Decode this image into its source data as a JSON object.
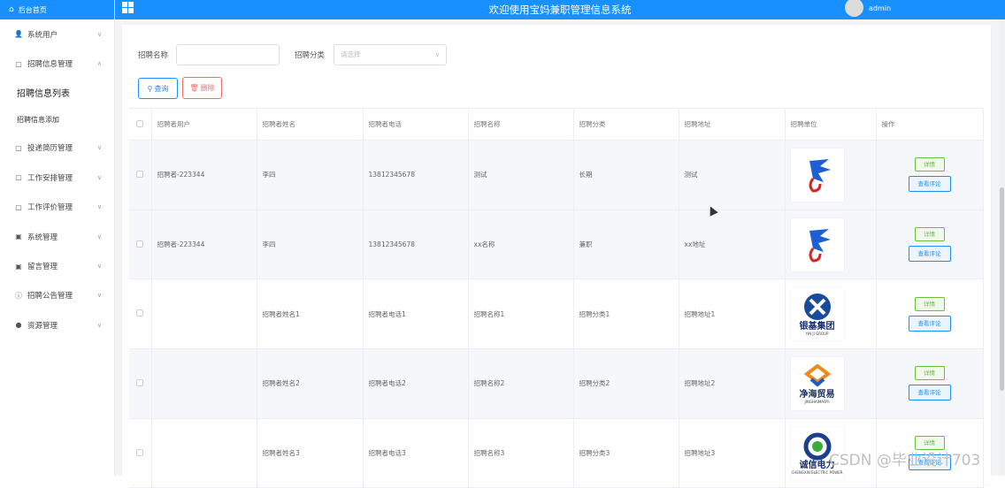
{
  "sidebar": {
    "home_label": "后台首页",
    "menu_top": [
      {
        "label": "系统用户",
        "icon": "user-icon"
      },
      {
        "label": "招聘信息管理",
        "icon": "doc-icon"
      }
    ],
    "submenu": [
      {
        "label": "招聘信息列表"
      },
      {
        "label": "招聘信息添加"
      }
    ],
    "menu_rest": [
      {
        "label": "投递简历管理",
        "icon": "doc-icon"
      },
      {
        "label": "工作安排管理",
        "icon": "doc-icon"
      },
      {
        "label": "工作评价管理",
        "icon": "doc-icon"
      },
      {
        "label": "系统管理",
        "icon": "image-icon"
      },
      {
        "label": "留言管理",
        "icon": "image-icon"
      },
      {
        "label": "招聘公告管理",
        "icon": "info-icon"
      },
      {
        "label": "资源管理",
        "icon": "dot-icon"
      }
    ]
  },
  "topbar": {
    "title": "欢迎使用宝妈兼职管理信息系统",
    "user": "admin",
    "accent": "#1890ff"
  },
  "search": {
    "name_label": "招聘名称",
    "name_value": "",
    "category_label": "招聘分类",
    "category_placeholder": "请选择",
    "search_button": "查询",
    "delete_button": "删除"
  },
  "table": {
    "headers": [
      "招聘者用户",
      "招聘者姓名",
      "招聘者电话",
      "招聘名称",
      "招聘分类",
      "招聘地址",
      "招聘单位",
      "操作"
    ],
    "rows": [
      {
        "user": "招聘者-223344",
        "name": "李四",
        "phone": "13812345678",
        "title": "测试",
        "category": "长期",
        "address": "测试",
        "logo": "eagle-logo"
      },
      {
        "user": "招聘者-223344",
        "name": "李四",
        "phone": "13812345678",
        "title": "xx名称",
        "category": "兼职",
        "address": "xx地址",
        "logo": "eagle-logo"
      },
      {
        "user": "",
        "name": "招聘者姓名1",
        "phone": "招聘者电话1",
        "title": "招聘名称1",
        "category": "招聘分类1",
        "address": "招聘地址1",
        "logo": "yinji-logo",
        "logo_text": "银基集团",
        "logo_sub": "YIN JI GROUP"
      },
      {
        "user": "",
        "name": "招聘者姓名2",
        "phone": "招聘者电话2",
        "title": "招聘名称2",
        "category": "招聘分类2",
        "address": "招聘地址2",
        "logo": "jinghai-logo",
        "logo_text": "净海贸易",
        "logo_sub": "JINGHAIMAOYI"
      },
      {
        "user": "",
        "name": "招聘者姓名3",
        "phone": "招聘者电话3",
        "title": "招聘名称3",
        "category": "招聘分类3",
        "address": "招聘地址3",
        "logo": "chengxin-logo",
        "logo_text": "诚信电力",
        "logo_sub": "CHENGXIN ELECTRIC POWER"
      }
    ],
    "detail_button": "详情",
    "comment_button": "查看评论"
  },
  "watermark": "CSDN @毕业设计703"
}
